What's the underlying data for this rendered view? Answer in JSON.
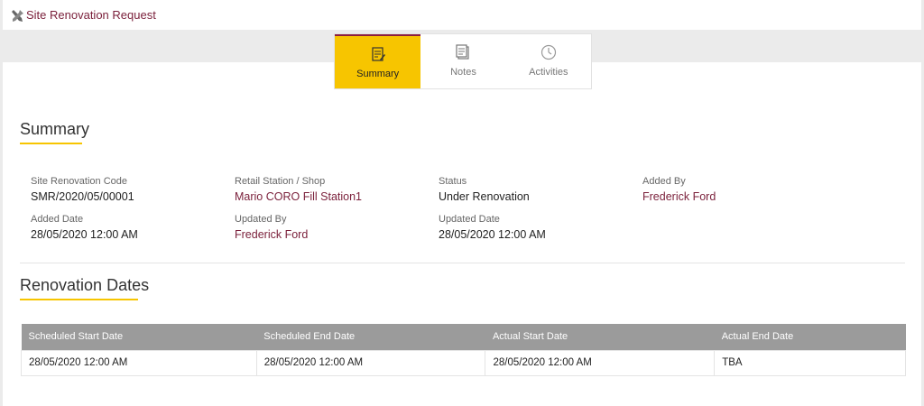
{
  "header": {
    "title": "Site Renovation Request",
    "icon": "tools-icon"
  },
  "tabs": [
    {
      "label": "Summary",
      "icon": "clipboard-edit-icon",
      "active": true
    },
    {
      "label": "Notes",
      "icon": "notes-icon",
      "active": false
    },
    {
      "label": "Activities",
      "icon": "clock-icon",
      "active": false
    }
  ],
  "summary": {
    "title": "Summary",
    "fields": {
      "code": {
        "label": "Site Renovation Code",
        "value": "SMR/2020/05/00001"
      },
      "station": {
        "label": "Retail Station / Shop",
        "value": "Mario CORO Fill Station1"
      },
      "status": {
        "label": "Status",
        "value": "Under Renovation"
      },
      "added_by": {
        "label": "Added By",
        "value": "Frederick Ford"
      },
      "added_date": {
        "label": "Added Date",
        "value": "28/05/2020 12:00 AM"
      },
      "updated_by": {
        "label": "Updated By",
        "value": "Frederick Ford"
      },
      "updated_date": {
        "label": "Updated Date",
        "value": "28/05/2020 12:00 AM"
      }
    }
  },
  "renovation_dates": {
    "title": "Renovation Dates",
    "columns": [
      "Scheduled Start Date",
      "Scheduled End Date",
      "Actual Start Date",
      "Actual End Date"
    ],
    "rows": [
      [
        "28/05/2020 12:00 AM",
        "28/05/2020 12:00 AM",
        "28/05/2020 12:00 AM",
        "TBA"
      ]
    ]
  },
  "colors": {
    "accent": "#f7c500",
    "brand": "#7a1f3a",
    "table_header": "#9b9b9b"
  }
}
